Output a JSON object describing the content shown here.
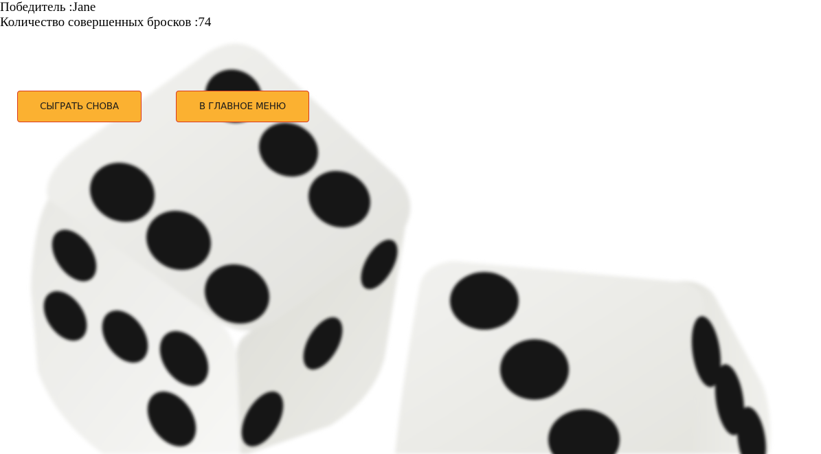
{
  "result": {
    "winner_label": "Победитель :",
    "winner_name": "Jane",
    "throws_label": "Количество совершенных бросков :",
    "throws_count": "74"
  },
  "buttons": {
    "play_again": "СЫГРАТЬ СНОВА",
    "main_menu": "В ГЛАВНОЕ МЕНЮ"
  },
  "colors": {
    "button_fill": "#fbb131",
    "button_border": "#d9381e",
    "pip": "#111111",
    "die_face": "#ededea"
  },
  "background": {
    "subject": "two white dice with black pips",
    "die_left_top_face": 6,
    "die_right_front_face": 3
  }
}
